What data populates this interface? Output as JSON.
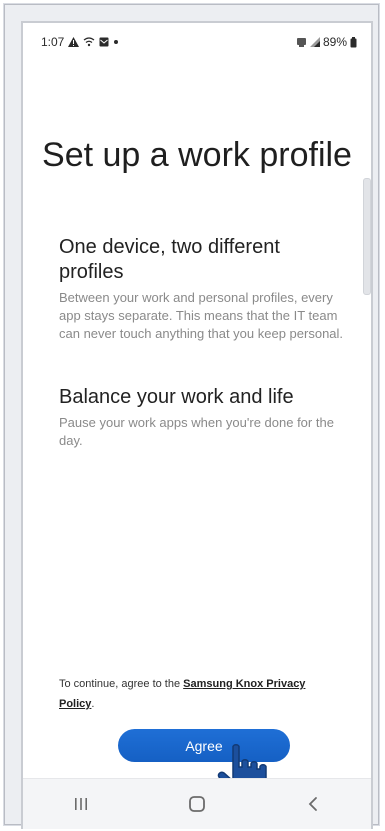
{
  "status_bar": {
    "time": "1:07",
    "battery": "89%",
    "icons": [
      "alert-icon",
      "wifi-calling-icon",
      "mail-icon",
      "dot-icon",
      "notification-icon",
      "signal-icon",
      "battery-icon"
    ]
  },
  "page": {
    "title": "Set up a work profile",
    "sections": [
      {
        "heading": "One device, two different profiles",
        "body": "Between your work and personal profiles, every app stays separate. This means that the IT team can never touch anything that you keep personal."
      },
      {
        "heading": "Balance your work and life",
        "body": "Pause your work apps when you're done for the day."
      }
    ]
  },
  "consent": {
    "prefix": "To continue, agree to the ",
    "link_text": "Samsung Knox Privacy Policy",
    "suffix": "."
  },
  "agree_button": {
    "label": "Agree",
    "color": "#1a6ad8"
  },
  "nav_bar": {
    "buttons": [
      "recents-icon",
      "home-icon",
      "back-icon"
    ]
  }
}
